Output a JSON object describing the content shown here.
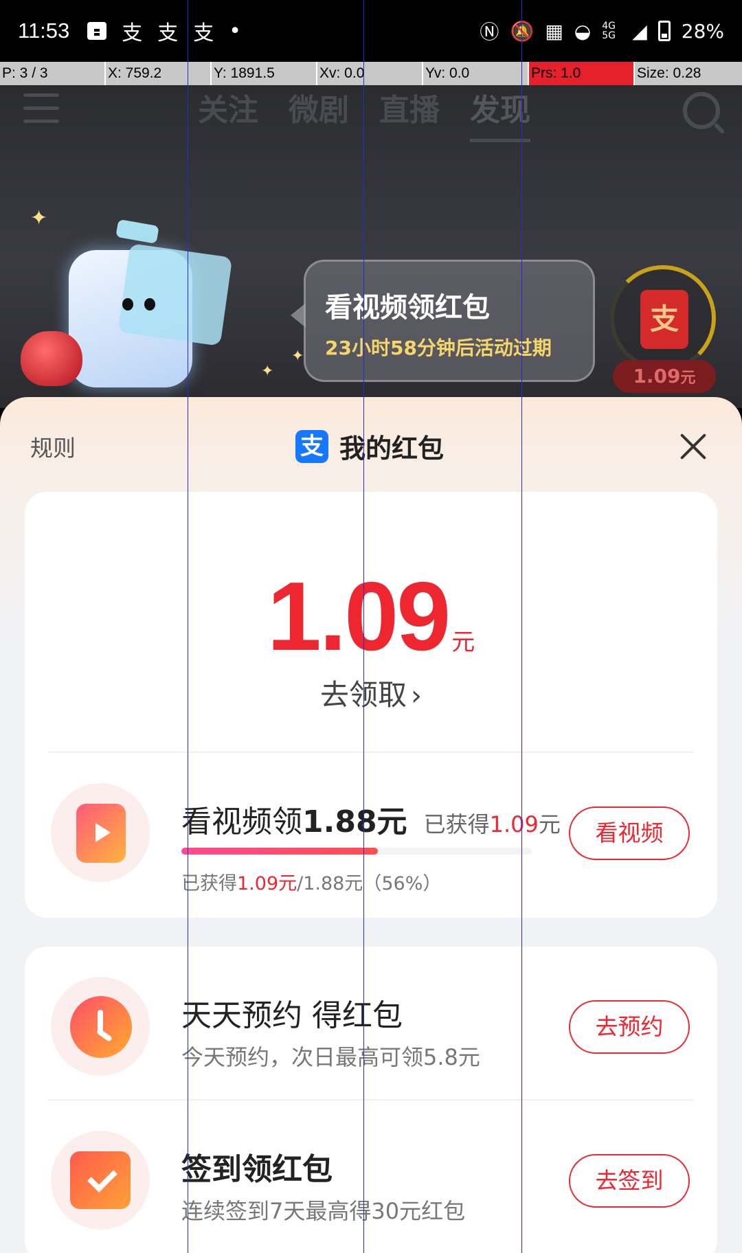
{
  "status_bar": {
    "time": "11:53",
    "left_icons": [
      "notification-icon",
      "alipay-icon",
      "alipay-icon",
      "alipay-icon",
      "dot-icon"
    ],
    "network": "4G 5G",
    "battery": "28%"
  },
  "debug_bar": {
    "p": "P: 3 / 3",
    "x": "X: 759.2",
    "y": "Y: 1891.5",
    "xv": "Xv: 0.0",
    "yv": "Yv: 0.0",
    "prs": "Prs: 1.0",
    "size": "Size: 0.28"
  },
  "top_nav": {
    "tabs": [
      {
        "label": "关注"
      },
      {
        "label": "微剧"
      },
      {
        "label": "直播"
      },
      {
        "label": "发现"
      }
    ],
    "active_tab": "发现"
  },
  "banner": {
    "title": "看视频领红包",
    "subtitle": "23小时58分钟后活动过期",
    "widget_amount": "1.09",
    "widget_unit": "元",
    "widget_glyph": "支"
  },
  "sheet": {
    "rules_label": "规则",
    "title": "我的红包",
    "logo_glyph": "支",
    "balance": "1.09",
    "balance_unit": "元",
    "claim_label": "去领取"
  },
  "tasks": [
    {
      "title_prefix": "看视频领",
      "title_amount": "1.88元",
      "earned_prefix": "已获得",
      "earned_value": "1.09",
      "earned_suffix": "元",
      "progress_fraction": 0.56,
      "progress_prefix": "已获得",
      "progress_value": "1.09元",
      "progress_suffix": "/1.88元（56%）",
      "button": "看视频",
      "icon": "play-icon"
    },
    {
      "title": "天天预约 得红包",
      "subtitle": "今天预约，次日最高可领5.8元",
      "button": "去预约",
      "icon": "clock-icon"
    },
    {
      "title": "签到领红包",
      "subtitle": "连续签到7天最高得30元红包",
      "button": "去签到",
      "icon": "calendar-icon"
    }
  ],
  "colors": {
    "accent_red": "#ee2630",
    "alipay_blue": "#1677ff",
    "bubble_subtitle": "#f6d66c"
  }
}
